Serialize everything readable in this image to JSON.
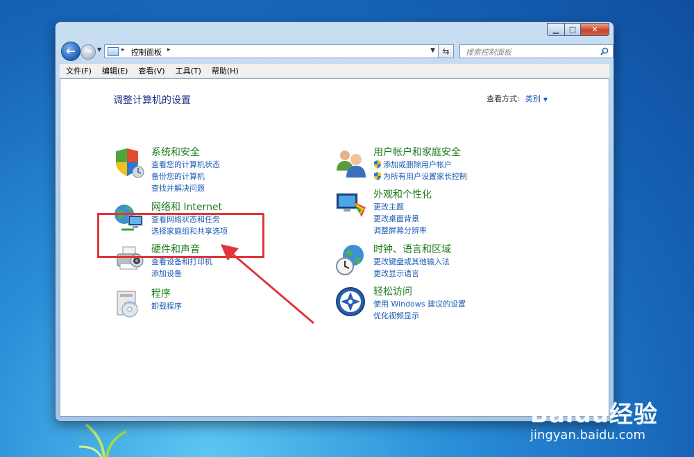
{
  "window": {
    "caption": {
      "minimize": "▁",
      "maximize": "□",
      "close": "✕"
    },
    "nav": {
      "back_icon": "←",
      "forward_icon": "→"
    },
    "address": {
      "separator": "▸",
      "path": "控制面板",
      "end_separator": "▸"
    },
    "search": {
      "placeholder": "搜索控制面板"
    },
    "menu": [
      "文件(F)",
      "编辑(E)",
      "查看(V)",
      "工具(T)",
      "帮助(H)"
    ]
  },
  "panel": {
    "title": "调整计算机的设置",
    "view_by_label": "查看方式:",
    "view_by_value": "类别",
    "categories_left": [
      {
        "title": "系统和安全",
        "icon": "shield-icon",
        "links": [
          "查看您的计算机状态",
          "备份您的计算机",
          "查找并解决问题"
        ]
      },
      {
        "title": "网络和 Internet",
        "icon": "network-globe-icon",
        "links": [
          "查看网络状态和任务",
          "选择家庭组和共享选项"
        ]
      },
      {
        "title": "硬件和声音",
        "icon": "printer-speaker-icon",
        "links": [
          "查看设备和打印机",
          "添加设备"
        ]
      },
      {
        "title": "程序",
        "icon": "programs-icon",
        "links": [
          "卸载程序"
        ]
      }
    ],
    "categories_right": [
      {
        "title": "用户帐户和家庭安全",
        "icon": "users-icon",
        "links": [
          "添加或删除用户帐户",
          "为所有用户设置家长控制"
        ]
      },
      {
        "title": "外观和个性化",
        "icon": "monitor-palette-icon",
        "links": [
          "更改主题",
          "更改桌面背景",
          "调整屏幕分辨率"
        ]
      },
      {
        "title": "时钟、语言和区域",
        "icon": "clock-globe-icon",
        "links": [
          "更改键盘或其他输入法",
          "更改显示语言"
        ]
      },
      {
        "title": "轻松访问",
        "icon": "ease-of-access-icon",
        "links": [
          "使用 Windows 建议的设置",
          "优化视频显示"
        ]
      }
    ]
  },
  "colors": {
    "title_green": "#1a7a1a",
    "link_blue": "#1a5bb5",
    "highlight_red": "#e0353a"
  },
  "watermark": {
    "main": "Baidu经验",
    "sub": "jingyan.baidu.com"
  }
}
